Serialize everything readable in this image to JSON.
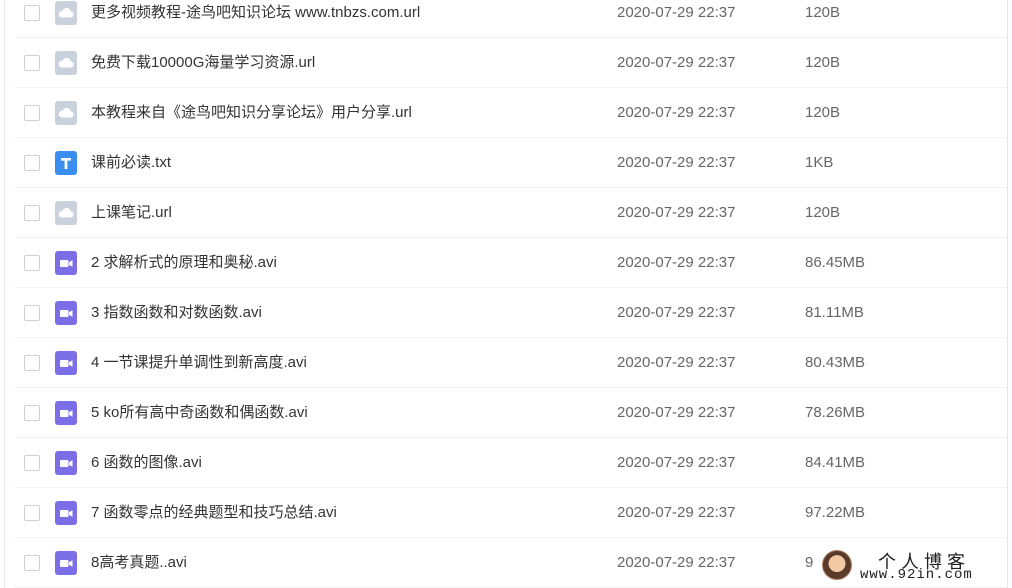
{
  "files": [
    {
      "type": "url",
      "icon": "link-file-icon",
      "name": "更多视频教程-途鸟吧知识论坛 www.tnbzs.com.url",
      "date": "2020-07-29 22:37",
      "size": "120B"
    },
    {
      "type": "url",
      "icon": "link-file-icon",
      "name": "免费下载10000G海量学习资源.url",
      "date": "2020-07-29 22:37",
      "size": "120B"
    },
    {
      "type": "url",
      "icon": "link-file-icon",
      "name": "本教程来自《途鸟吧知识分享论坛》用户分享.url",
      "date": "2020-07-29 22:37",
      "size": "120B"
    },
    {
      "type": "txt",
      "icon": "text-file-icon",
      "name": "课前必读.txt",
      "date": "2020-07-29 22:37",
      "size": "1KB"
    },
    {
      "type": "url",
      "icon": "link-file-icon",
      "name": "上课笔记.url",
      "date": "2020-07-29 22:37",
      "size": "120B"
    },
    {
      "type": "video",
      "icon": "video-file-icon",
      "name": "2 求解析式的原理和奥秘.avi",
      "date": "2020-07-29 22:37",
      "size": "86.45MB"
    },
    {
      "type": "video",
      "icon": "video-file-icon",
      "name": "3 指数函数和对数函数.avi",
      "date": "2020-07-29 22:37",
      "size": "81.11MB"
    },
    {
      "type": "video",
      "icon": "video-file-icon",
      "name": "4 一节课提升单调性到新高度.avi",
      "date": "2020-07-29 22:37",
      "size": "80.43MB"
    },
    {
      "type": "video",
      "icon": "video-file-icon",
      "name": "5 ko所有高中奇函数和偶函数.avi",
      "date": "2020-07-29 22:37",
      "size": "78.26MB"
    },
    {
      "type": "video",
      "icon": "video-file-icon",
      "name": "6 函数的图像.avi",
      "date": "2020-07-29 22:37",
      "size": "84.41MB"
    },
    {
      "type": "video",
      "icon": "video-file-icon",
      "name": "7 函数零点的经典题型和技巧总结.avi",
      "date": "2020-07-29 22:37",
      "size": "97.22MB"
    },
    {
      "type": "video",
      "icon": "video-file-icon",
      "name": "8高考真题..avi",
      "date": "2020-07-29 22:37",
      "size": "9"
    }
  ],
  "watermark": {
    "title": "个人博客",
    "url": "www.92in.com"
  },
  "colors": {
    "url_icon": "#c9d2dc",
    "txt_icon": "#3a8ef0",
    "video_icon": "#7b6ee6"
  }
}
